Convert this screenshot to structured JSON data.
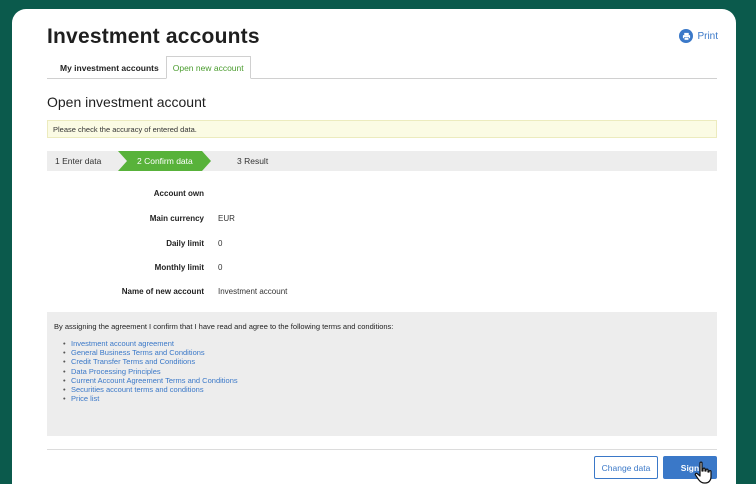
{
  "header": {
    "title": "Investment accounts",
    "print_label": "Print"
  },
  "tabs": [
    {
      "label": "My investment accounts",
      "active": false
    },
    {
      "label": "Open new account",
      "active": true
    }
  ],
  "page": {
    "subtitle": "Open investment account",
    "notice": "Please check the accuracy of entered data."
  },
  "steps": [
    {
      "label": "1  Enter data",
      "active": false
    },
    {
      "label": "2  Confirm data",
      "active": true
    },
    {
      "label": "3  Result",
      "active": false
    }
  ],
  "form": [
    {
      "label": "Account own",
      "value": ""
    },
    {
      "label": "Main currency",
      "value": "EUR"
    },
    {
      "label": "Daily limit",
      "value": "0"
    },
    {
      "label": "Monthly limit",
      "value": "0"
    },
    {
      "label": "Name of new account",
      "value": "Investment account"
    }
  ],
  "terms": {
    "heading": "By assigning the agreement I confirm that I have read and agree to the following terms and conditions:",
    "links": [
      "Investment account agreement",
      "General Business Terms and Conditions",
      "Credit Transfer Terms and Conditions",
      "Data Processing Principles",
      "Current Account Agreement Terms and Conditions",
      "Securities account terms and conditions",
      "Price list"
    ]
  },
  "actions": {
    "change_label": "Change data",
    "sign_label": "Sign"
  },
  "colors": {
    "background": "#0b5a4c",
    "accent_green": "#58b23a",
    "link_blue": "#3a78c8"
  },
  "icons": {
    "print": "printer-icon",
    "cursor": "hand-pointer-cursor-icon"
  }
}
